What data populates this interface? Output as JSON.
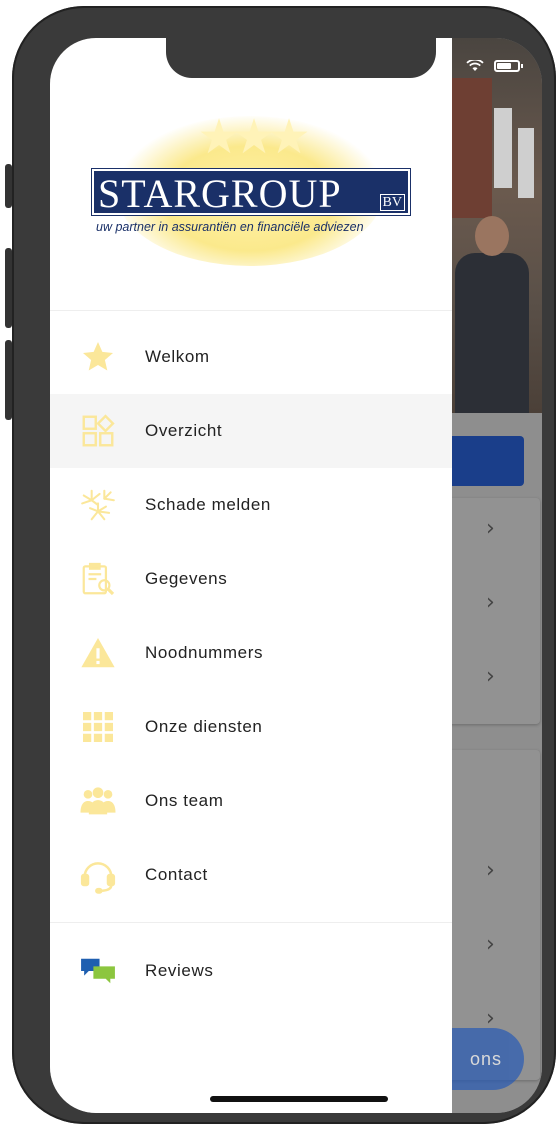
{
  "logo": {
    "name": "STARGROUP",
    "suffix": "BV",
    "tagline": "uw partner in assurantiën en financiële adviezen"
  },
  "menu": [
    {
      "label": "Welkom",
      "icon": "star-icon"
    },
    {
      "label": "Overzicht",
      "icon": "widgets-icon",
      "active": true
    },
    {
      "label": "Schade melden",
      "icon": "fireworks-icon"
    },
    {
      "label": "Gegevens",
      "icon": "clipboard-search-icon"
    },
    {
      "label": "Noodnummers",
      "icon": "warning-icon"
    },
    {
      "label": "Onze diensten",
      "icon": "grid-icon"
    },
    {
      "label": "Ons team",
      "icon": "team-icon"
    },
    {
      "label": "Contact",
      "icon": "headset-icon"
    }
  ],
  "secondary_menu": [
    {
      "label": "Reviews",
      "icon": "chat-bubbles-icon"
    }
  ],
  "background": {
    "fab_label": "ons"
  },
  "colors": {
    "icon": "#fbe79a",
    "brand_navy": "#1a3068",
    "active_bg": "#f5f5f5"
  }
}
